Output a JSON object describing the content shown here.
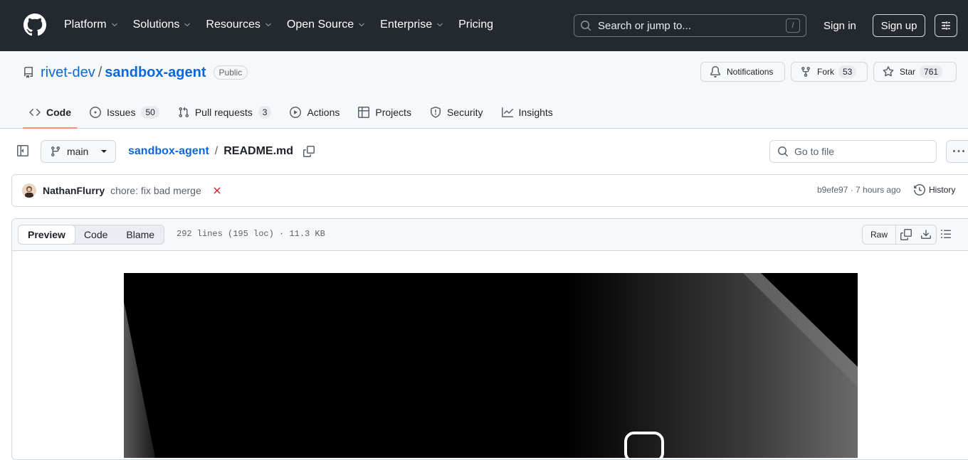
{
  "header": {
    "nav": [
      {
        "label": "Platform",
        "dropdown": true
      },
      {
        "label": "Solutions",
        "dropdown": true
      },
      {
        "label": "Resources",
        "dropdown": true
      },
      {
        "label": "Open Source",
        "dropdown": true
      },
      {
        "label": "Enterprise",
        "dropdown": true
      },
      {
        "label": "Pricing",
        "dropdown": false
      }
    ],
    "search_placeholder": "Search or jump to...",
    "search_shortcut": "/",
    "sign_in": "Sign in",
    "sign_up": "Sign up"
  },
  "repo": {
    "owner": "rivet-dev",
    "separator": "/",
    "name": "sandbox-agent",
    "visibility": "Public",
    "notifications_label": "Notifications",
    "fork_label": "Fork",
    "fork_count": "53",
    "star_label": "Star",
    "star_count": "761",
    "tabs": [
      {
        "label": "Code",
        "icon": "code-icon",
        "count": null,
        "active": true
      },
      {
        "label": "Issues",
        "icon": "issue-icon",
        "count": "50",
        "active": false
      },
      {
        "label": "Pull requests",
        "icon": "pull-request-icon",
        "count": "3",
        "active": false
      },
      {
        "label": "Actions",
        "icon": "play-icon",
        "count": null,
        "active": false
      },
      {
        "label": "Projects",
        "icon": "table-icon",
        "count": null,
        "active": false
      },
      {
        "label": "Security",
        "icon": "shield-icon",
        "count": null,
        "active": false
      },
      {
        "label": "Insights",
        "icon": "graph-icon",
        "count": null,
        "active": false
      }
    ]
  },
  "file_nav": {
    "branch": "main",
    "breadcrumb_repo": "sandbox-agent",
    "breadcrumb_sep": "/",
    "file_name": "README.md",
    "goto_placeholder": "Go to file"
  },
  "commit": {
    "author": "NathanFlurry",
    "message": "chore: fix bad merge",
    "status": "failure",
    "sha_time": "b9efe97 · 7 hours ago",
    "history_label": "History"
  },
  "file": {
    "views": [
      {
        "label": "Preview",
        "active": true
      },
      {
        "label": "Code",
        "active": false
      },
      {
        "label": "Blame",
        "active": false
      }
    ],
    "info": "292 lines (195 loc) · 11.3 KB",
    "raw_label": "Raw"
  },
  "colors": {
    "header_bg": "#24292f",
    "link": "#0969da",
    "active_tab_underline": "#fd8c73",
    "failure": "#d1242f"
  }
}
